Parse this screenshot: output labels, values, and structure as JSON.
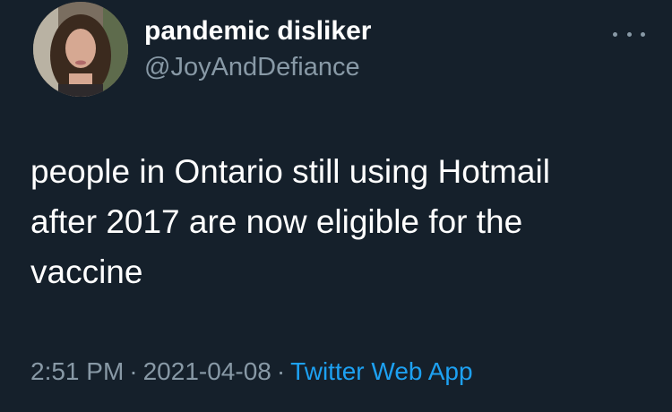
{
  "tweet": {
    "display_name": "pandemic disliker",
    "handle": "@JoyAndDefiance",
    "text": "people in Ontario still using Hotmail\nafter 2017 are now eligible for the\nvaccine",
    "time": "2:51 PM",
    "separator": "·",
    "date": "2021-04-08",
    "source": "Twitter Web App"
  },
  "icons": {
    "more": "more-horizontal-icon"
  },
  "colors": {
    "background": "#15202b",
    "primary_text": "#ffffff",
    "secondary_text": "#8899a6",
    "link": "#1da1f2"
  }
}
